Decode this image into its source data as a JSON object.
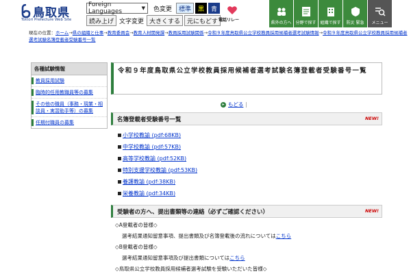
{
  "header": {
    "site_title": "鳥取県",
    "site_subtitle": "Tottori Prefecture Web Site",
    "language_select": "Foreign Languages",
    "color_change_label": "色変更",
    "color_standard": "標準",
    "color_black": "黒",
    "color_blue": "青",
    "read_aloud": "読み上げ",
    "font_change": "文字変更",
    "larger": "大きくする",
    "reset": "元にもどす",
    "pictogram_label": "電話リレー",
    "nav": [
      {
        "label": "県外の方へ",
        "bg": "#3c8a3c",
        "icon": "people-icon"
      },
      {
        "label": "分野で探す",
        "bg": "#3c8a3c",
        "icon": "document-icon"
      },
      {
        "label": "組織で探す",
        "bg": "#3c8a3c",
        "icon": "building-icon"
      },
      {
        "label": "防災 緊急",
        "bg": "#3c8a3c",
        "icon": "emergency-icon"
      },
      {
        "label": "メニュー",
        "bg": "#555555",
        "icon": "menu-search-icon"
      }
    ]
  },
  "breadcrumb": {
    "prefix": "現在の位置：",
    "items": [
      "ホーム",
      "県の組織と仕事",
      "教育委員会",
      "教育人材開発課",
      "教員採用試験関係",
      "令和９年度鳥取県公立学校教員採用候補者選考試験情報",
      "令和９年度鳥取県公立学校教員採用候補者選考試験名簿登載者受験番号一覧"
    ],
    "separator": "→"
  },
  "sidebar": {
    "heading": "各種試験情報",
    "items": [
      "教員採用試験",
      "臨時的任用教職員等の募集",
      "その他の職員（事務・現業・相談員・実習助手等）の募集",
      "任期付職員の募集"
    ]
  },
  "main": {
    "title": "令和９年度鳥取県公立学校教員採用候補者選考試験名簿登載者受験番号一覧",
    "toc_link": "もどる",
    "toc_sep": "|",
    "section1_heading": "名簿登載者受験番号一覧",
    "new_badge": "NEW!",
    "documents": [
      "小学校教諭 (pdf:68KB)",
      "中学校教諭 (pdf:57KB)",
      "高等学校教諭 (pdf:52KB)",
      "特別支援学校教諭 (pdf:53KB)",
      "養護教諭 (pdf:38KB)",
      "栄養教諭 (pdf:34KB)"
    ],
    "section2_heading": "受験者の方へ、提出書類等の連絡（必ずご確認ください）",
    "notice": {
      "a_head": "◇A登載者の皆様◇",
      "a_text": "選考結果通知留意事項、提出書類及び名簿登載後の流れについては",
      "a_link": "こちら",
      "b_head": "◇B登載者の皆様◇",
      "b_text": "選考結果通知留意事項及び提出書類については",
      "b_link": "こちら",
      "c_head": "◇鳥取県公立学校教員採用候補者選考試験を受験いただいた皆様◇"
    }
  }
}
